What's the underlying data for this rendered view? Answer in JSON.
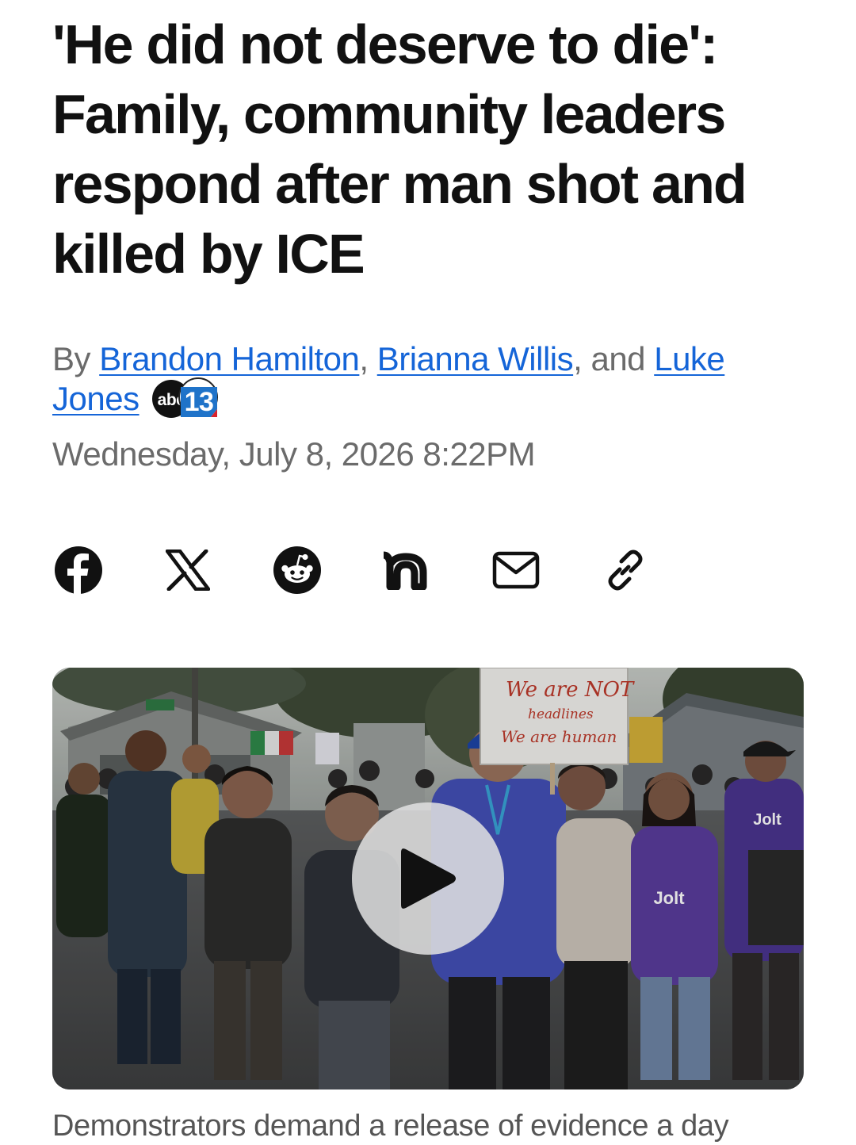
{
  "article": {
    "headline": "'He did not deserve to die': Family, community leaders respond after man shot and killed by ICE",
    "byline": {
      "prefix": "By ",
      "authors": [
        "Brandon Hamilton",
        "Brianna Willis",
        "Luke Jones"
      ],
      "separator": ", ",
      "last_separator": ", and "
    },
    "station_logo": {
      "left_text": "abc",
      "number": "13"
    },
    "dateline": "Wednesday, July 8, 2026 8:22PM"
  },
  "share": {
    "icons": [
      "facebook-icon",
      "x-icon",
      "reddit-icon",
      "nextdoor-icon",
      "email-icon",
      "link-icon"
    ]
  },
  "media": {
    "sign": {
      "line1": "We are NOT",
      "line2": "headlines",
      "line3": "We are human"
    },
    "shirt_text": "Jolt",
    "play_icon": "play-icon"
  },
  "caption": "Demonstrators demand a release of evidence a day",
  "colors": {
    "link": "#1565d8",
    "headline": "#111111",
    "meta": "#6b6b6b",
    "abc13_blue": "#1f73c9",
    "abc13_red": "#d9232e"
  }
}
